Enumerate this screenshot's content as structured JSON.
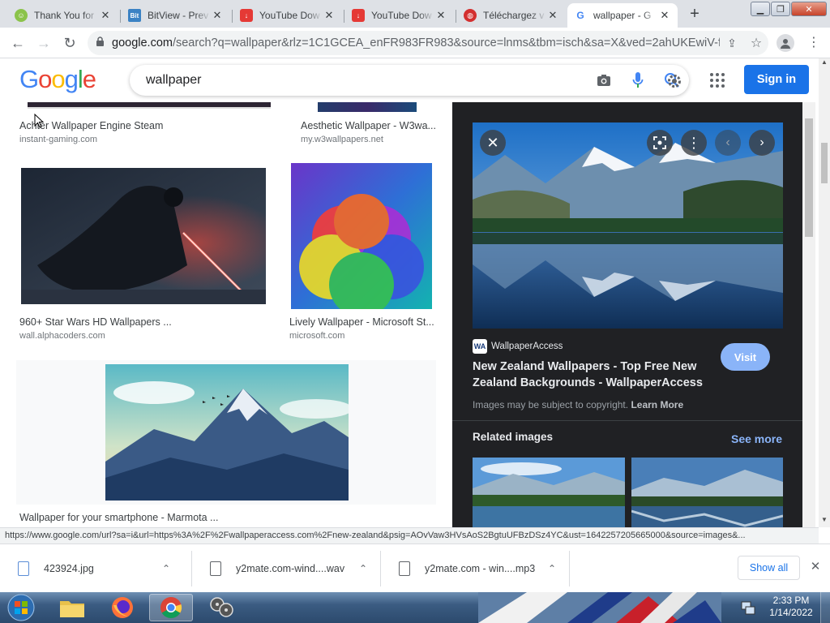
{
  "tabs": [
    {
      "title": "Thank You for",
      "active": false
    },
    {
      "title": "BitView - Prev",
      "active": false
    },
    {
      "title": "YouTube Dow",
      "active": false
    },
    {
      "title": "YouTube Dow",
      "active": false
    },
    {
      "title": "Téléchargez v",
      "active": false
    },
    {
      "title": "wallpaper - G",
      "active": true
    }
  ],
  "browser": {
    "url_host": "google.com",
    "url_path": "/search?q=wallpaper&rlz=1C1GCEA_enFR983FR983&source=lnms&tbm=isch&sa=X&ved=2ahUKEwiV-fr..."
  },
  "search": {
    "query": "wallpaper",
    "signin_label": "Sign in",
    "logo_text": "Google"
  },
  "results": [
    {
      "caption": "Achter Wallpaper Engine Steam",
      "source": "instant-gaming.com"
    },
    {
      "caption": "Aesthetic Wallpaper - W3wa...",
      "source": "my.w3wallpapers.net"
    },
    {
      "caption": "960+ Star Wars HD Wallpapers ...",
      "source": "wall.alphacoders.com"
    },
    {
      "caption": "Lively Wallpaper - Microsoft St...",
      "source": "microsoft.com"
    },
    {
      "caption": "Wallpaper for your smartphone - Marmota ...",
      "source": ""
    }
  ],
  "panel": {
    "site_name": "WallpaperAccess",
    "site_logo": "WA",
    "title": "New Zealand Wallpapers - Top Free New Zealand Backgrounds - WallpaperAccess",
    "visit_label": "Visit",
    "copyright_text": "Images may be subject to copyright.",
    "learn_more": "Learn More",
    "related_label": "Related images",
    "see_more": "See more"
  },
  "status_url": "https://www.google.com/url?sa=i&url=https%3A%2F%2Fwallpaperaccess.com%2Fnew-zealand&psig=AOvVaw3HVsAoS2BgtuUFBzDSz4YC&ust=1642257205665000&source=images&...",
  "downloads": [
    {
      "name": "423924.jpg"
    },
    {
      "name": "y2mate.com-wind....wav"
    },
    {
      "name": "y2mate.com - win....mp3"
    }
  ],
  "downloads_show_all": "Show all",
  "clock": {
    "time": "2:33 PM",
    "date": "1/14/2022"
  },
  "colors": {
    "accent": "#1a73e8",
    "panel_bg": "#202124",
    "visit_button": "#8ab4f8",
    "see_more": "#8ab4f8"
  }
}
